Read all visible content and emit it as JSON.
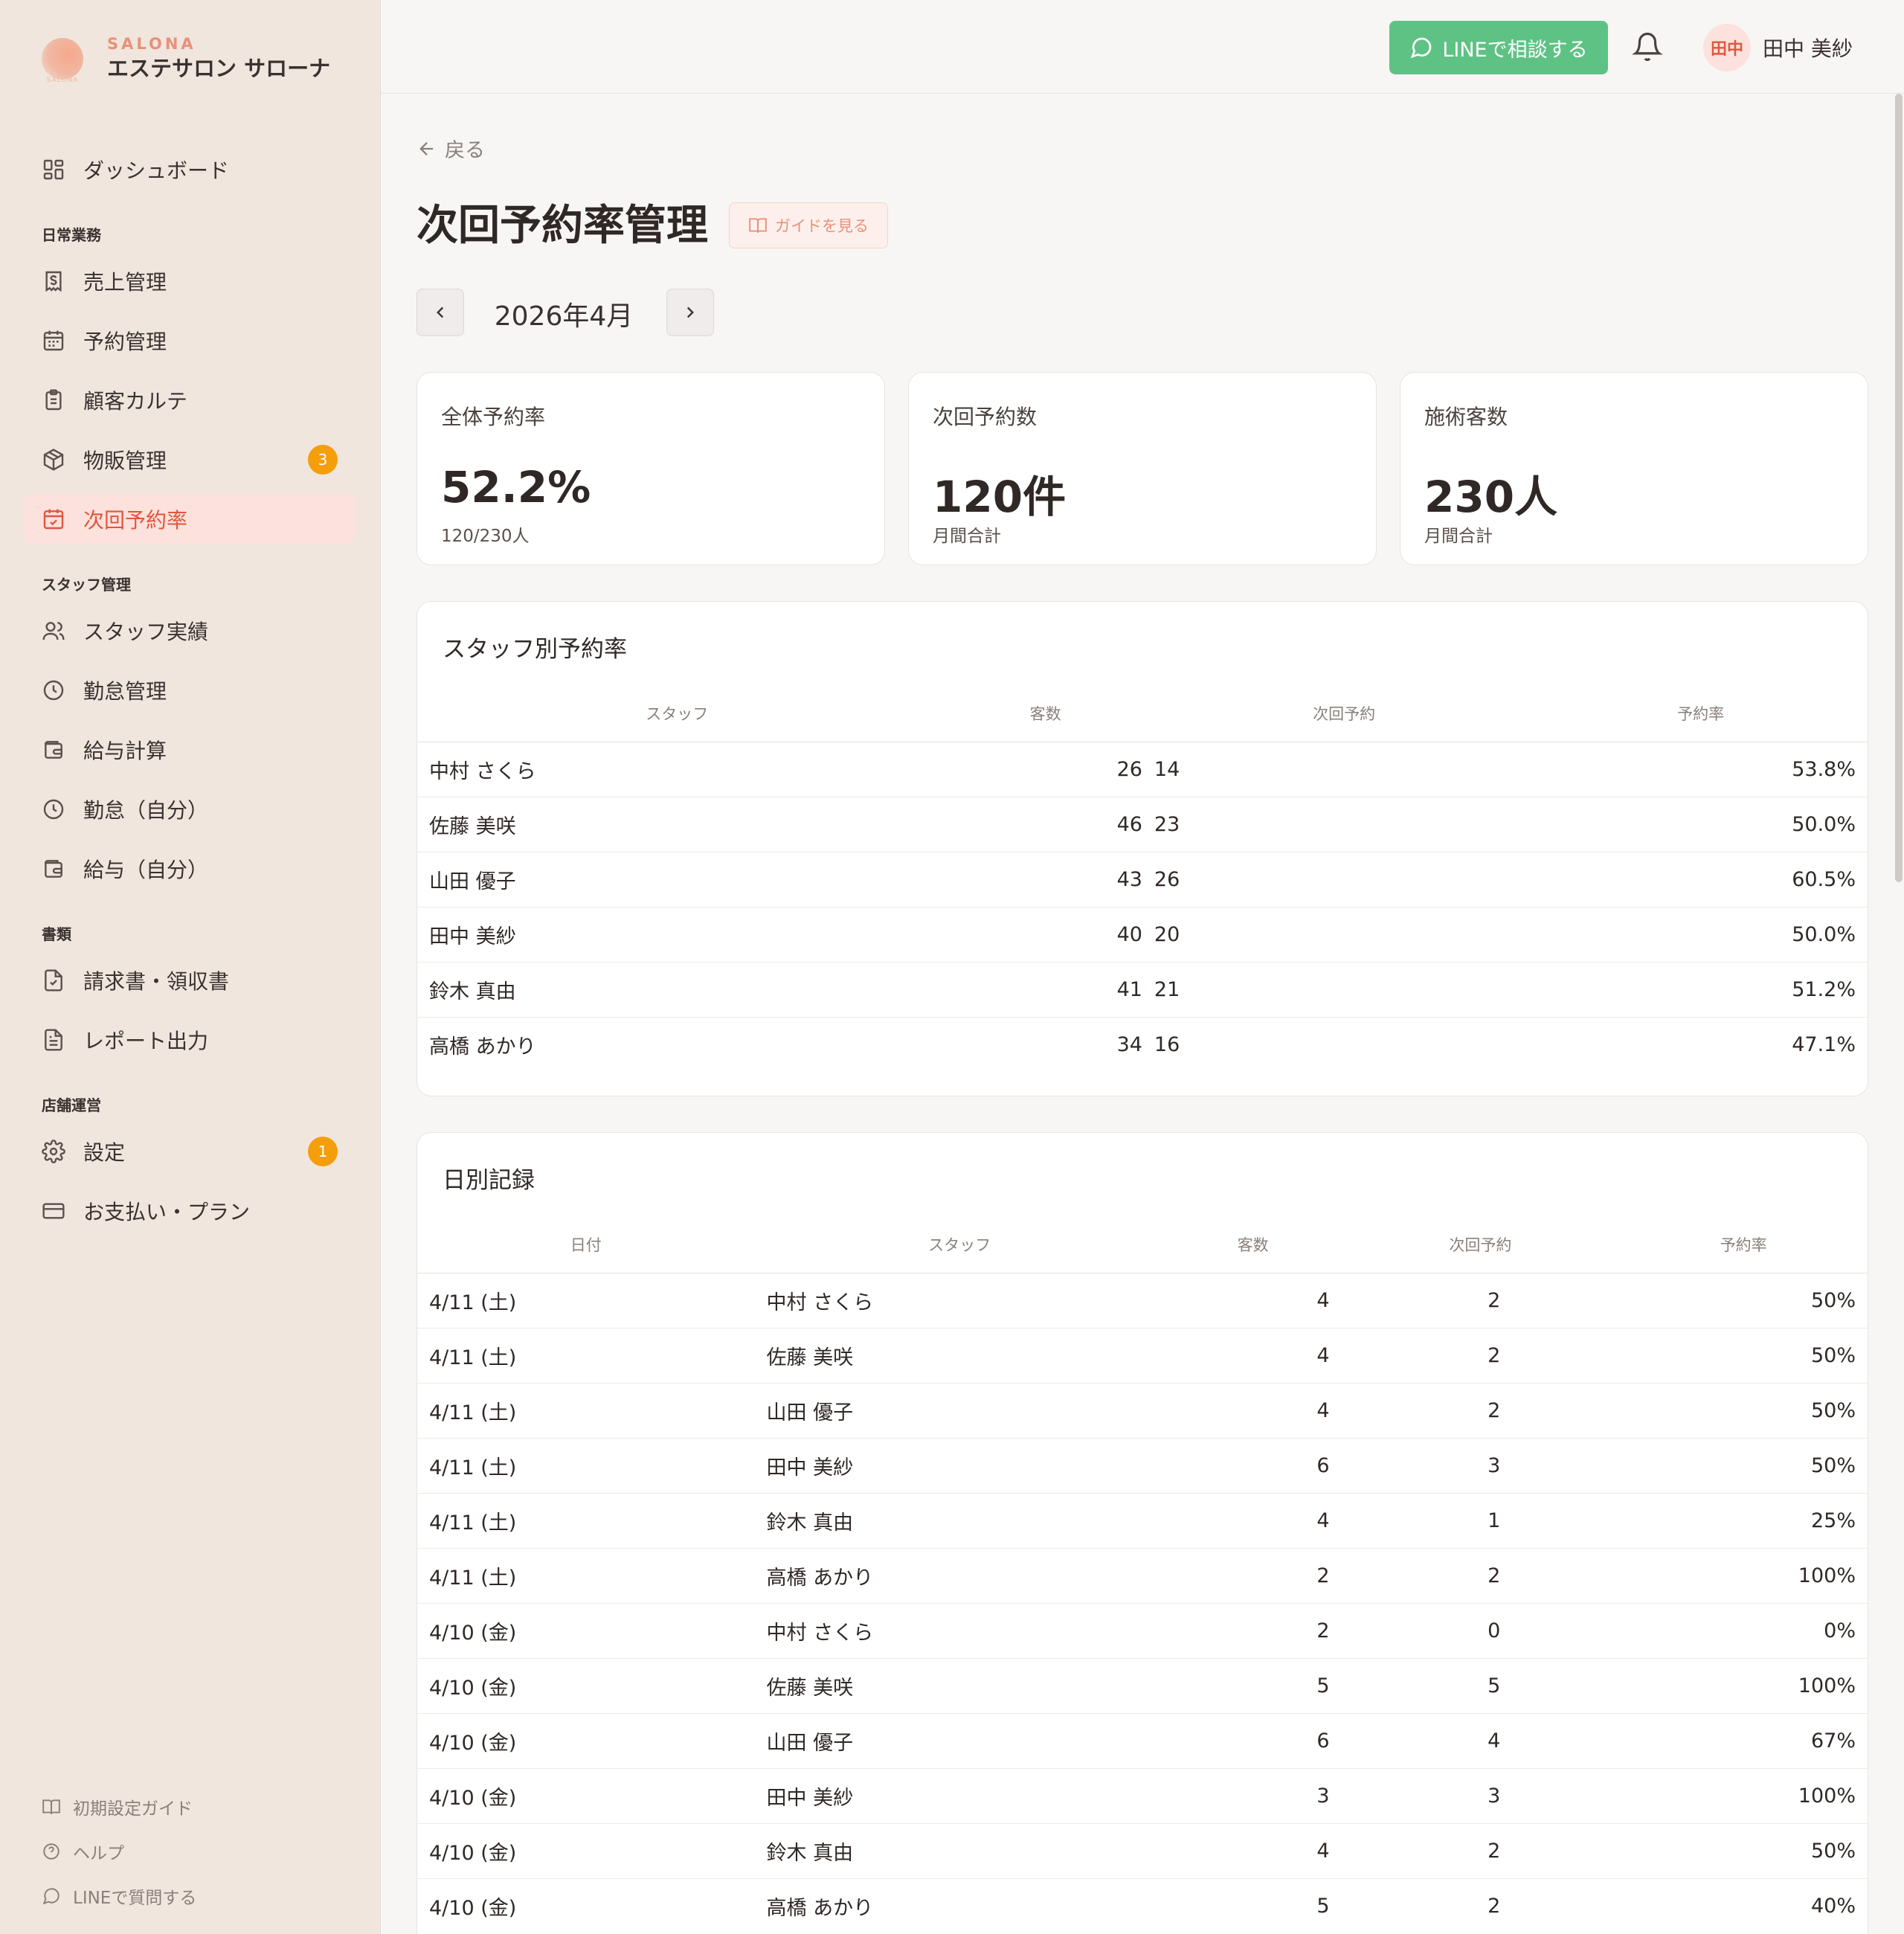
{
  "brand": {
    "sub": "SALONA",
    "name": "エステサロン サローナ",
    "logo_text": "SALONA"
  },
  "sidebar": {
    "dashboard": "ダッシュボード",
    "sections": {
      "daily": "日常業務",
      "staff": "スタッフ管理",
      "docs": "書類",
      "store": "店舗運営"
    },
    "items": {
      "sales": "売上管理",
      "reservation": "予約管理",
      "customer": "顧客カルテ",
      "products": "物販管理",
      "products_badge": "3",
      "next_rate": "次回予約率",
      "staff_perf": "スタッフ実績",
      "attendance": "勤怠管理",
      "payroll": "給与計算",
      "attendance_self": "勤怠（自分）",
      "payroll_self": "給与（自分）",
      "invoice": "請求書・領収書",
      "report": "レポート出力",
      "settings": "設定",
      "settings_badge": "1",
      "billing": "お支払い・プラン"
    },
    "footer": {
      "setup_guide": "初期設定ガイド",
      "help": "ヘルプ",
      "line_question": "LINEで質問する"
    }
  },
  "header": {
    "line_button": "LINEで相談する",
    "avatar_text": "田中",
    "user_name": "田中 美紗"
  },
  "main": {
    "back": "戻る",
    "title": "次回予約率管理",
    "guide_button": "ガイドを見る",
    "month": "2026年4月",
    "stats": [
      {
        "label": "全体予約率",
        "value": "52.2%",
        "sub": "120/230人"
      },
      {
        "label": "次回予約数",
        "value": "120件",
        "sub": "月間合計"
      },
      {
        "label": "施術客数",
        "value": "230人",
        "sub": "月間合計"
      }
    ],
    "staff_table": {
      "title": "スタッフ別予約率",
      "headers": {
        "staff": "スタッフ",
        "customers": "客数",
        "next": "次回予約",
        "rate": "予約率"
      },
      "rows": [
        {
          "staff": "中村 さくら",
          "customers": "26",
          "next": "14",
          "rate": "53.8%"
        },
        {
          "staff": "佐藤 美咲",
          "customers": "46",
          "next": "23",
          "rate": "50.0%"
        },
        {
          "staff": "山田 優子",
          "customers": "43",
          "next": "26",
          "rate": "60.5%"
        },
        {
          "staff": "田中 美紗",
          "customers": "40",
          "next": "20",
          "rate": "50.0%"
        },
        {
          "staff": "鈴木 真由",
          "customers": "41",
          "next": "21",
          "rate": "51.2%"
        },
        {
          "staff": "高橋 あかり",
          "customers": "34",
          "next": "16",
          "rate": "47.1%"
        }
      ]
    },
    "daily_table": {
      "title": "日別記録",
      "headers": {
        "date": "日付",
        "staff": "スタッフ",
        "customers": "客数",
        "next": "次回予約",
        "rate": "予約率"
      },
      "rows": [
        {
          "date": "4/11 (土)",
          "staff": "中村 さくら",
          "customers": "4",
          "next": "2",
          "rate": "50%"
        },
        {
          "date": "4/11 (土)",
          "staff": "佐藤 美咲",
          "customers": "4",
          "next": "2",
          "rate": "50%"
        },
        {
          "date": "4/11 (土)",
          "staff": "山田 優子",
          "customers": "4",
          "next": "2",
          "rate": "50%"
        },
        {
          "date": "4/11 (土)",
          "staff": "田中 美紗",
          "customers": "6",
          "next": "3",
          "rate": "50%"
        },
        {
          "date": "4/11 (土)",
          "staff": "鈴木 真由",
          "customers": "4",
          "next": "1",
          "rate": "25%"
        },
        {
          "date": "4/11 (土)",
          "staff": "高橋 あかり",
          "customers": "2",
          "next": "2",
          "rate": "100%"
        },
        {
          "date": "4/10 (金)",
          "staff": "中村 さくら",
          "customers": "2",
          "next": "0",
          "rate": "0%"
        },
        {
          "date": "4/10 (金)",
          "staff": "佐藤 美咲",
          "customers": "5",
          "next": "5",
          "rate": "100%"
        },
        {
          "date": "4/10 (金)",
          "staff": "山田 優子",
          "customers": "6",
          "next": "4",
          "rate": "67%"
        },
        {
          "date": "4/10 (金)",
          "staff": "田中 美紗",
          "customers": "3",
          "next": "3",
          "rate": "100%"
        },
        {
          "date": "4/10 (金)",
          "staff": "鈴木 真由",
          "customers": "4",
          "next": "2",
          "rate": "50%"
        },
        {
          "date": "4/10 (金)",
          "staff": "高橋 あかり",
          "customers": "5",
          "next": "2",
          "rate": "40%"
        }
      ]
    }
  }
}
